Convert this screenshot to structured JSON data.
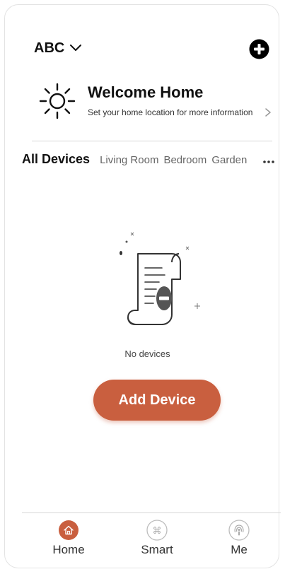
{
  "header": {
    "home_name": "ABC"
  },
  "welcome": {
    "title": "Welcome Home",
    "subtitle": "Set your home location for more information"
  },
  "tabs": [
    {
      "label": "All Devices",
      "active": true
    },
    {
      "label": "Living Room",
      "active": false
    },
    {
      "label": "Bedroom",
      "active": false
    },
    {
      "label": "Garden",
      "active": false
    }
  ],
  "empty_state": {
    "message": "No devices",
    "button_label": "Add Device"
  },
  "bottom_nav": [
    {
      "label": "Home",
      "icon": "home-icon",
      "active": true
    },
    {
      "label": "Smart",
      "icon": "command-icon",
      "active": false
    },
    {
      "label": "Me",
      "icon": "profile-icon",
      "active": false
    }
  ],
  "colors": {
    "accent": "#c95f3f",
    "inactive_icon": "#bdbdbd"
  }
}
